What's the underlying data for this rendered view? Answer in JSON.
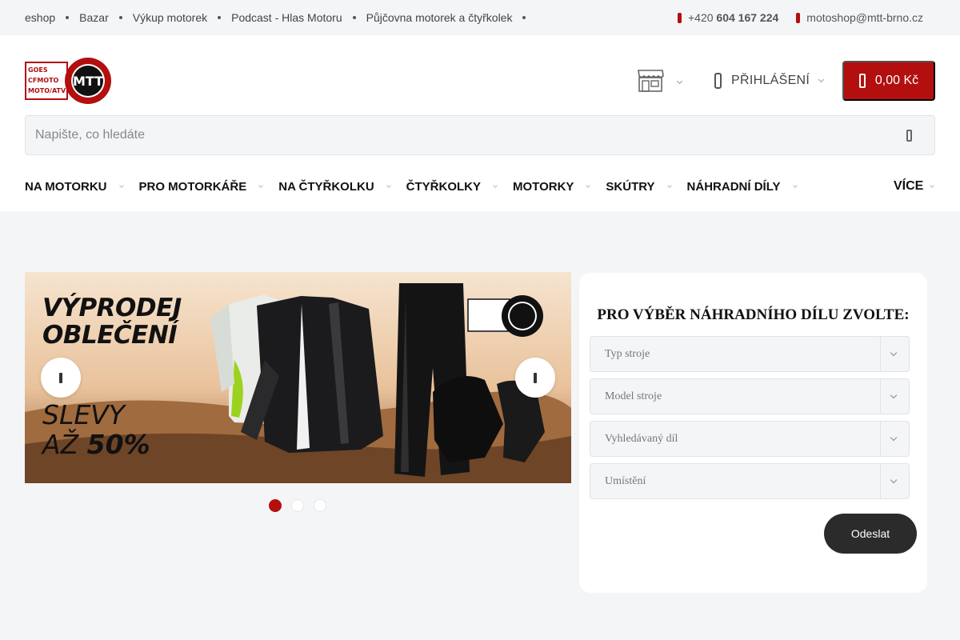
{
  "topbar": {
    "links": [
      "eshop",
      "Bazar",
      "Výkup motorek",
      "Podcast - Hlas Motoru",
      "Půjčovna motorek a čtyřkolek"
    ],
    "phone_prefix": "+420",
    "phone_number": "604 167 224",
    "email": "motoshop@mtt-brno.cz"
  },
  "header": {
    "logo_text": "MTT",
    "login_label": "PŘIHLÁŠENÍ",
    "cart_total": "0,00 Kč",
    "search_placeholder": "Napište, co hledáte"
  },
  "nav": {
    "items": [
      "NA MOTORKU",
      "PRO MOTORKÁŘE",
      "NA ČTYŘKOLKU",
      "ČTYŘKOLKY",
      "MOTORKY",
      "SKÚTRY",
      "NÁHRADNÍ DÍLY"
    ],
    "more": "VÍCE"
  },
  "banner": {
    "title_line1": "VÝPRODEJ",
    "title_line2": "OBLEČENÍ",
    "sale_line1": "SLEVY",
    "sale_line2_prefix": "AŽ ",
    "sale_line2_value": "50%",
    "slide_count": 3,
    "active_slide": 1
  },
  "parts_finder": {
    "title": "PRO VÝBĚR NÁHRADNÍHO DÍLU ZVOLTE:",
    "selects": [
      "Typ stroje",
      "Model stroje",
      "Vyhledávaný díl",
      "Umístění"
    ],
    "submit_label": "Odeslat"
  },
  "colors": {
    "brand_red": "#b30f0f",
    "dark": "#2b2b2b"
  }
}
